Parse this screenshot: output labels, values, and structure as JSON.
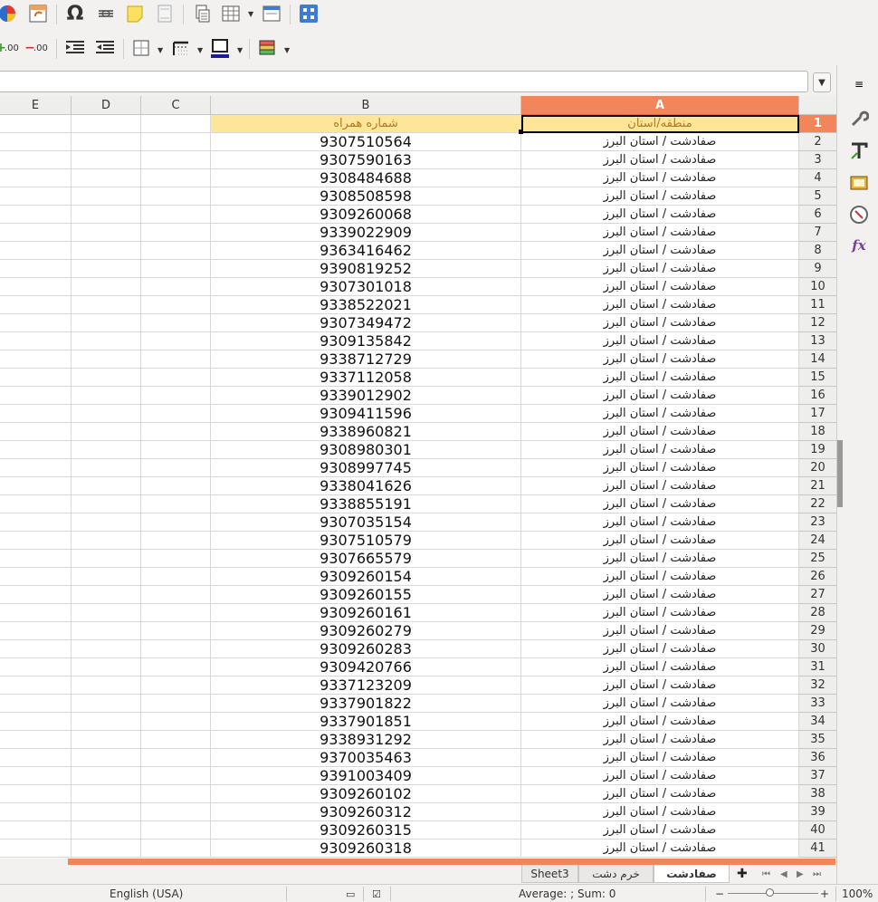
{
  "toolbar1": {
    "icons": [
      "chart-icon",
      "pivot-table-icon",
      "special-character-icon",
      "hyperlink-icon",
      "comment-icon",
      "header-footer-icon",
      "print-range-icon",
      "freeze-rows-columns-icon",
      "form-controls-icon",
      "navigator-icon"
    ],
    "omega_glyph": "Ω"
  },
  "toolbar2": {
    "icons": [
      "add-decimal-place-icon",
      "delete-decimal-place-icon",
      "increase-indent-icon",
      "decrease-indent-icon",
      "borders-icon",
      "border-style-icon",
      "border-color-icon",
      "conditional-format-icon"
    ],
    "add_decimal_label": ".00",
    "delete_decimal_label": ".00",
    "border_color": "#1a1a9c"
  },
  "columns": [
    "E",
    "D",
    "C",
    "B",
    "A"
  ],
  "active_column": "A",
  "header_row": {
    "row_number": "1",
    "A": "منطقه/استان",
    "B": "شماره همراه"
  },
  "rows": [
    {
      "n": "2",
      "A": "صفادشت  /  استان البرز",
      "B": "9307510564"
    },
    {
      "n": "3",
      "A": "صفادشت  /  استان البرز",
      "B": "9307590163"
    },
    {
      "n": "4",
      "A": "صفادشت  /  استان البرز",
      "B": "9308484688"
    },
    {
      "n": "5",
      "A": "صفادشت  /  استان البرز",
      "B": "9308508598"
    },
    {
      "n": "6",
      "A": "صفادشت  /  استان البرز",
      "B": "9309260068"
    },
    {
      "n": "7",
      "A": "صفادشت  /  استان البرز",
      "B": "9339022909"
    },
    {
      "n": "8",
      "A": "صفادشت  /  استان البرز",
      "B": "9363416462"
    },
    {
      "n": "9",
      "A": "صفادشت  /  استان البرز",
      "B": "9390819252"
    },
    {
      "n": "10",
      "A": "صفادشت  /  استان البرز",
      "B": "9307301018"
    },
    {
      "n": "11",
      "A": "صفادشت  /  استان البرز",
      "B": "9338522021"
    },
    {
      "n": "12",
      "A": "صفادشت  /  استان البرز",
      "B": "9307349472"
    },
    {
      "n": "13",
      "A": "صفادشت  /  استان البرز",
      "B": "9309135842"
    },
    {
      "n": "14",
      "A": "صفادشت  /  استان البرز",
      "B": "9338712729"
    },
    {
      "n": "15",
      "A": "صفادشت  /  استان البرز",
      "B": "9337112058"
    },
    {
      "n": "16",
      "A": "صفادشت  /  استان البرز",
      "B": "9339012902"
    },
    {
      "n": "17",
      "A": "صفادشت  /  استان البرز",
      "B": "9309411596"
    },
    {
      "n": "18",
      "A": "صفادشت  /  استان البرز",
      "B": "9338960821"
    },
    {
      "n": "19",
      "A": "صفادشت  /  استان البرز",
      "B": "9308980301"
    },
    {
      "n": "20",
      "A": "صفادشت  /  استان البرز",
      "B": "9308997745"
    },
    {
      "n": "21",
      "A": "صفادشت  /  استان البرز",
      "B": "9338041626"
    },
    {
      "n": "22",
      "A": "صفادشت  /  استان البرز",
      "B": "9338855191"
    },
    {
      "n": "23",
      "A": "صفادشت  /  استان البرز",
      "B": "9307035154"
    },
    {
      "n": "24",
      "A": "صفادشت  /  استان البرز",
      "B": "9307510579"
    },
    {
      "n": "25",
      "A": "صفادشت  /  استان البرز",
      "B": "9307665579"
    },
    {
      "n": "26",
      "A": "صفادشت  /  استان البرز",
      "B": "9309260154"
    },
    {
      "n": "27",
      "A": "صفادشت  /  استان البرز",
      "B": "9309260155"
    },
    {
      "n": "28",
      "A": "صفادشت  /  استان البرز",
      "B": "9309260161"
    },
    {
      "n": "29",
      "A": "صفادشت  /  استان البرز",
      "B": "9309260279"
    },
    {
      "n": "30",
      "A": "صفادشت  /  استان البرز",
      "B": "9309260283"
    },
    {
      "n": "31",
      "A": "صفادشت  /  استان البرز",
      "B": "9309420766"
    },
    {
      "n": "32",
      "A": "صفادشت  /  استان البرز",
      "B": "9337123209"
    },
    {
      "n": "33",
      "A": "صفادشت  /  استان البرز",
      "B": "9337901822"
    },
    {
      "n": "34",
      "A": "صفادشت  /  استان البرز",
      "B": "9337901851"
    },
    {
      "n": "35",
      "A": "صفادشت  /  استان البرز",
      "B": "9338931292"
    },
    {
      "n": "36",
      "A": "صفادشت  /  استان البرز",
      "B": "9370035463"
    },
    {
      "n": "37",
      "A": "صفادشت  /  استان البرز",
      "B": "9391003409"
    },
    {
      "n": "38",
      "A": "صفادشت  /  استان البرز",
      "B": "9309260102"
    },
    {
      "n": "39",
      "A": "صفادشت  /  استان البرز",
      "B": "9309260312"
    },
    {
      "n": "40",
      "A": "صفادشت  /  استان البرز",
      "B": "9309260315"
    },
    {
      "n": "41",
      "A": "صفادشت  /  استان البرز",
      "B": "9309260318"
    }
  ],
  "sidebar": {
    "icons": [
      "sidebar-menu-icon",
      "properties-icon",
      "styles-icon",
      "gallery-icon",
      "navigator-icon",
      "functions-icon"
    ]
  },
  "sheet_tabs": [
    "Sheet3",
    "خرم دشت",
    "صفادشت"
  ],
  "active_sheet": "صفادشت",
  "tab_nav": {
    "add": "✚",
    "first": "⏮",
    "prev": "◀",
    "next": "▶",
    "last": "⏭"
  },
  "status": {
    "language": "English (USA)",
    "summary": "Average: ; Sum: 0",
    "zoom": "100%",
    "zoom_minus": "−",
    "zoom_plus": "+"
  },
  "colors": {
    "accent": "#f3855b",
    "header_fill": "#ffe59a",
    "header_text": "#b07a1e"
  }
}
